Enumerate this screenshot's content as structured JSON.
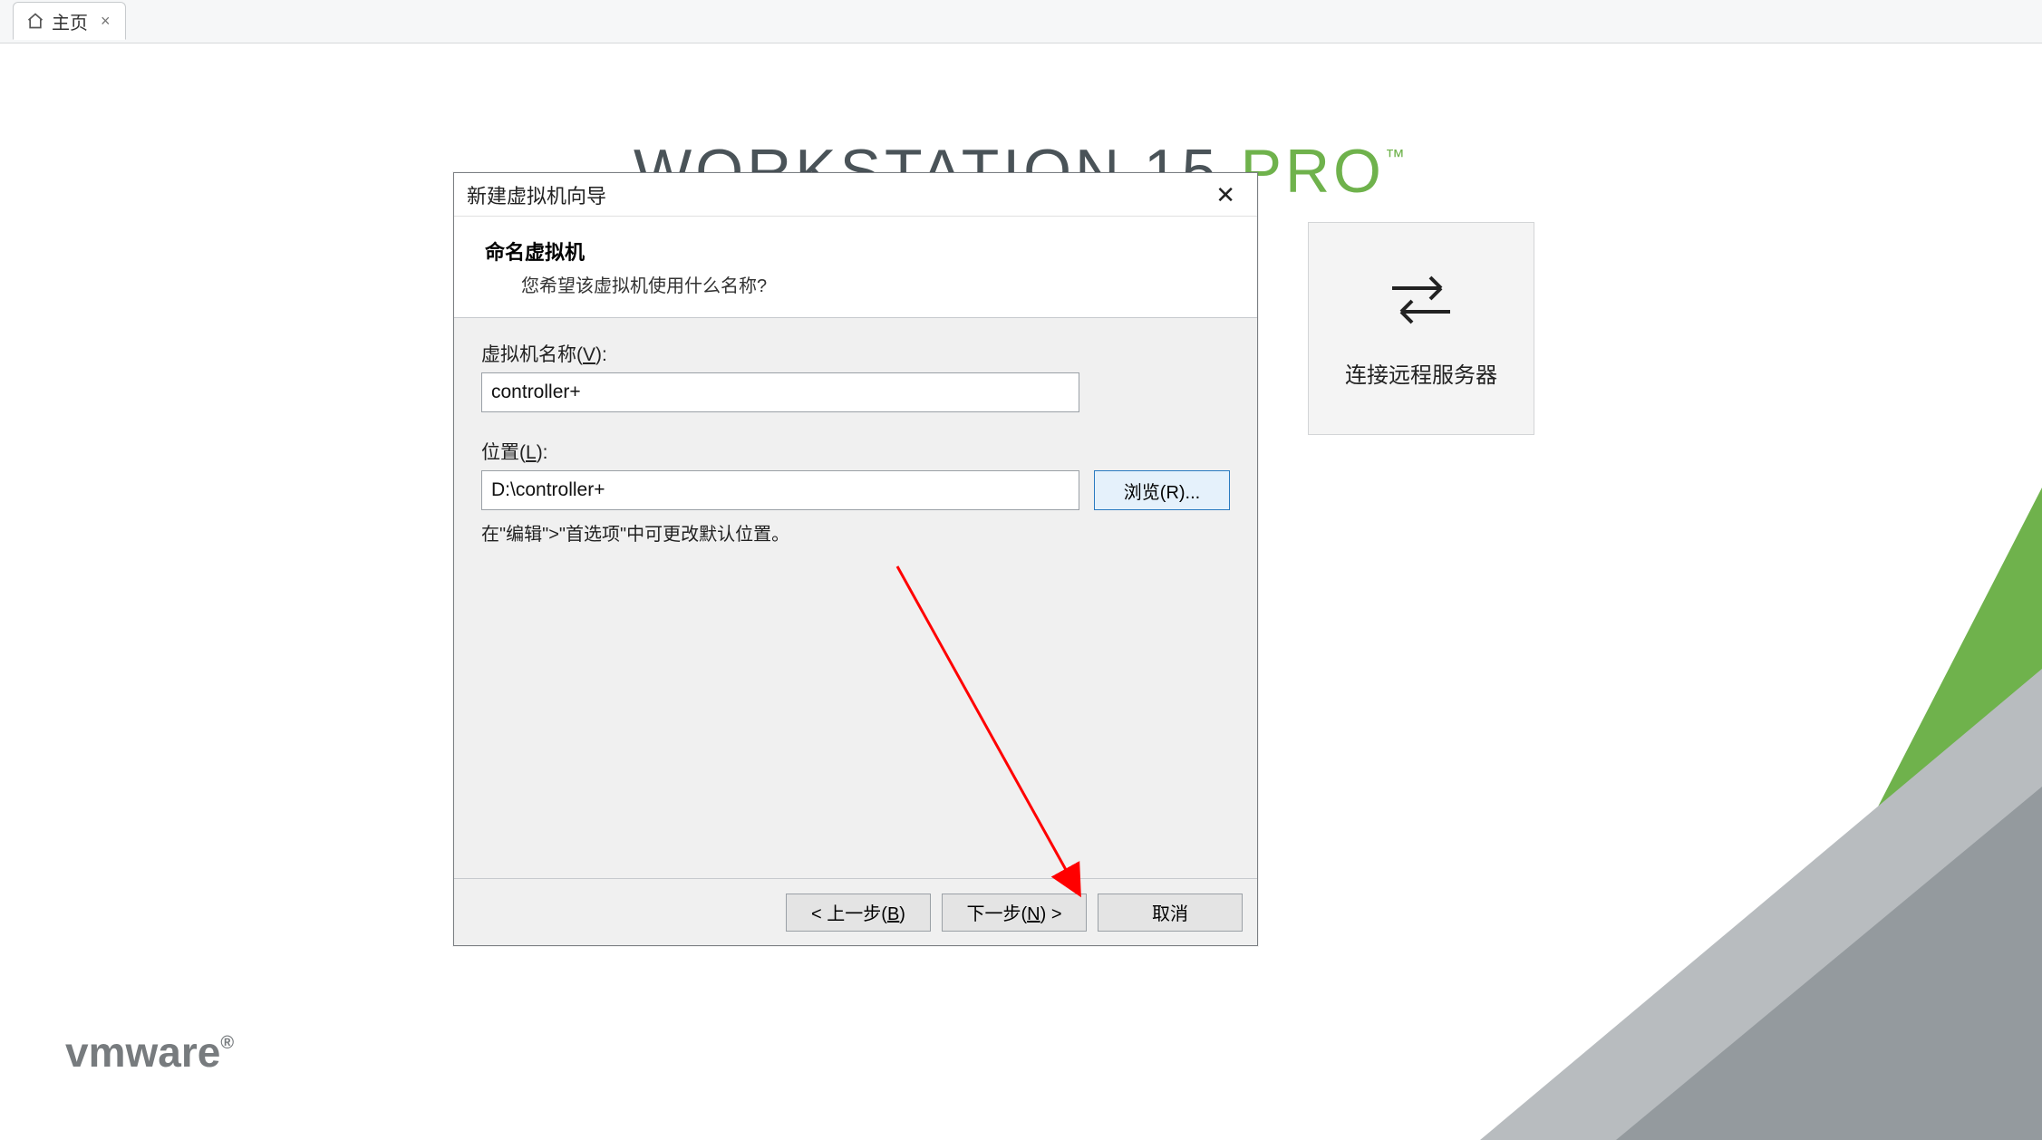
{
  "tab": {
    "label": "主页"
  },
  "bg_title": {
    "ws": "WORKSTATION 15 ",
    "pro": "PRO",
    "tm": "™"
  },
  "card_remote": {
    "label": "连接远程服务器"
  },
  "wizard": {
    "title": "新建虚拟机向导",
    "heading": "命名虚拟机",
    "subheading": "您希望该虚拟机使用什么名称?",
    "name_label_pre": "虚拟机名称(",
    "name_label_u": "V",
    "name_label_post": "):",
    "name_value": "controller+",
    "loc_label_pre": "位置(",
    "loc_label_u": "L",
    "loc_label_post": "):",
    "loc_value": "D:\\controller+",
    "browse_pre": "浏览(",
    "browse_u": "R",
    "browse_post": ")...",
    "hint": "在\"编辑\">\"首选项\"中可更改默认位置。",
    "btn_back_pre": "< 上一步(",
    "btn_back_u": "B",
    "btn_back_post": ")",
    "btn_next_pre": "下一步(",
    "btn_next_u": "N",
    "btn_next_post": ") >",
    "btn_cancel": "取消"
  },
  "logo": {
    "text": "vmware",
    "reg": "®"
  }
}
